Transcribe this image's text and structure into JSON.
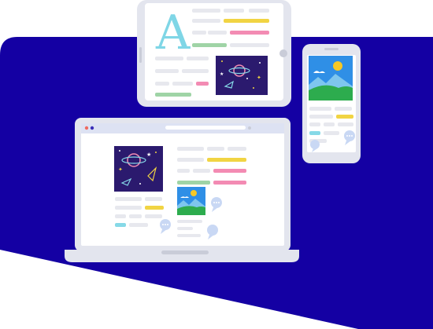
{
  "headline": {
    "letter": "A"
  },
  "colors": {
    "background_shape": "#1400a3",
    "device_frame": "#e3e5ee",
    "device_screen": "#ffffff",
    "placeholder_gray": "#e7e8ee",
    "placeholder_yellow": "#f1d443",
    "placeholder_pink": "#f38bb3",
    "placeholder_green": "#9fd4a6",
    "placeholder_cyan": "#86d9e7",
    "space_card": "#2b1a6e",
    "sky_blue": "#2f8fe6",
    "grass_green": "#2dac4e",
    "sun_yellow": "#f7c824",
    "speech_bubble": "#c9d8f4",
    "browser_bar": "#dde2f3",
    "dot_red": "#ef6b5f",
    "dot_navy": "#3b2fb8"
  },
  "icons": {
    "big_letter": "letter-a-icon",
    "space_scene": "planet-rocket-icon",
    "landscape": "mountain-sun-icon",
    "comment": "speech-bubble-icon"
  }
}
